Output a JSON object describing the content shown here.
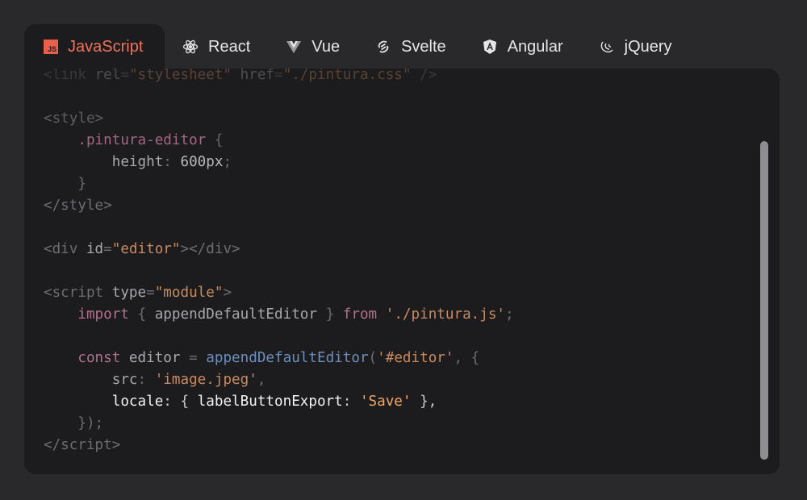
{
  "tabs": [
    {
      "label": "JavaScript",
      "icon": "javascript-icon",
      "active": true
    },
    {
      "label": "React",
      "icon": "react-icon"
    },
    {
      "label": "Vue",
      "icon": "vue-icon"
    },
    {
      "label": "Svelte",
      "icon": "svelte-icon"
    },
    {
      "label": "Angular",
      "icon": "angular-icon"
    },
    {
      "label": "jQuery",
      "icon": "jquery-icon"
    }
  ],
  "js_badge": "JS",
  "code": {
    "lines": [
      {
        "opacity": 0.35,
        "tokens": [
          [
            "tag",
            "<link "
          ],
          [
            "attr",
            "rel"
          ],
          [
            "punc",
            "="
          ],
          [
            "str",
            "\"stylesheet\""
          ],
          [
            "attr",
            " href"
          ],
          [
            "punc",
            "="
          ],
          [
            "str",
            "\"./pintura.css\""
          ],
          [
            "punc",
            " />"
          ]
        ]
      },
      {
        "tokens": []
      },
      {
        "opacity": 0.8,
        "tokens": [
          [
            "tag",
            "<style>"
          ]
        ]
      },
      {
        "opacity": 0.9,
        "tokens": [
          [
            "sel",
            "    .pintura-editor"
          ],
          [
            "punc",
            " {"
          ]
        ]
      },
      {
        "tokens": [
          [
            "attr",
            "        height"
          ],
          [
            "punc",
            ": "
          ],
          [
            "num",
            "600px"
          ],
          [
            "punc",
            ";"
          ]
        ]
      },
      {
        "tokens": [
          [
            "punc",
            "    }"
          ]
        ]
      },
      {
        "tokens": [
          [
            "tag",
            "</style>"
          ]
        ]
      },
      {
        "tokens": []
      },
      {
        "tokens": [
          [
            "tag",
            "<div "
          ],
          [
            "attr",
            "id"
          ],
          [
            "punc",
            "="
          ],
          [
            "str",
            "\"editor\""
          ],
          [
            "tag",
            "></div>"
          ]
        ]
      },
      {
        "tokens": []
      },
      {
        "tokens": [
          [
            "tag",
            "<script "
          ],
          [
            "attr",
            "type"
          ],
          [
            "punc",
            "="
          ],
          [
            "str",
            "\"module\""
          ],
          [
            "tag",
            ">"
          ]
        ]
      },
      {
        "tokens": [
          [
            "kw",
            "    import"
          ],
          [
            "punc",
            " { "
          ],
          [
            "plain",
            "appendDefaultEditor"
          ],
          [
            "punc",
            " } "
          ],
          [
            "kw",
            "from"
          ],
          [
            "str",
            " './pintura.js'"
          ],
          [
            "punc",
            ";"
          ]
        ]
      },
      {
        "tokens": []
      },
      {
        "tokens": [
          [
            "kw",
            "    const"
          ],
          [
            "plain",
            " editor "
          ],
          [
            "punc",
            "= "
          ],
          [
            "fn",
            "appendDefaultEditor"
          ],
          [
            "punc",
            "("
          ],
          [
            "str",
            "'#editor'"
          ],
          [
            "punc",
            ", {"
          ]
        ]
      },
      {
        "tokens": [
          [
            "attr",
            "        src"
          ],
          [
            "punc",
            ": "
          ],
          [
            "str",
            "'image.jpeg'"
          ],
          [
            "punc",
            ","
          ]
        ]
      },
      {
        "bright": true,
        "tokens": [
          [
            "attr",
            "        locale"
          ],
          [
            "punc",
            ": { "
          ],
          [
            "attr",
            "labelButtonExport"
          ],
          [
            "punc",
            ": "
          ],
          [
            "str",
            "'Save'"
          ],
          [
            "punc",
            " },"
          ]
        ]
      },
      {
        "tokens": [
          [
            "punc",
            "    });"
          ]
        ]
      },
      {
        "tokens": [
          [
            "tag",
            "</script>"
          ]
        ]
      }
    ]
  }
}
